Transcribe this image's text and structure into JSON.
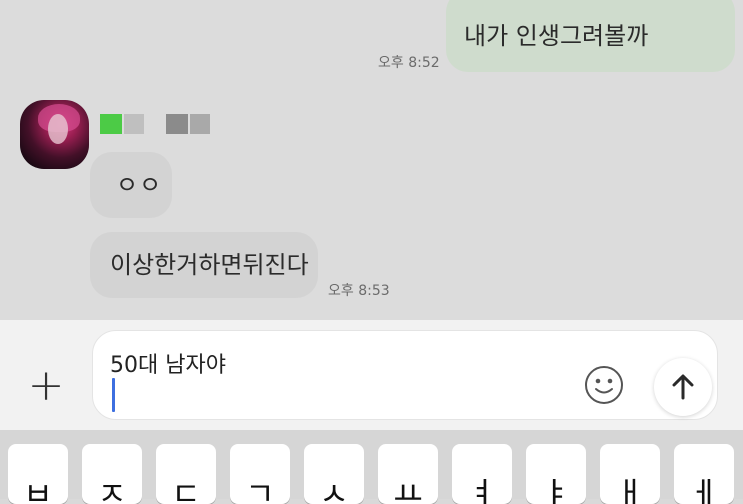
{
  "messages": {
    "mine_1": {
      "text": "내가 인생그려볼까",
      "time": "오후 8:52"
    },
    "other_1": {
      "text": "ㅇㅇ"
    },
    "other_2": {
      "text": "이상한거하면뒤진다",
      "time": "오후 8:53"
    }
  },
  "input": {
    "value": "50대 남자야"
  },
  "icons": {
    "attach": "plus-icon",
    "emoji": "smiley-icon",
    "send": "arrow-up-icon"
  },
  "keyboard": {
    "row1": [
      "ㅂ",
      "ㅈ",
      "ㄷ",
      "ㄱ",
      "ㅅ",
      "ㅛ",
      "ㅕ",
      "ㅑ",
      "ㅐ",
      "ㅔ"
    ]
  },
  "colors": {
    "my_bubble": "#cfdccd",
    "other_bubble": "#d3d3d3",
    "chat_background": "#dcdcdc",
    "caret": "#3d6fe0"
  }
}
